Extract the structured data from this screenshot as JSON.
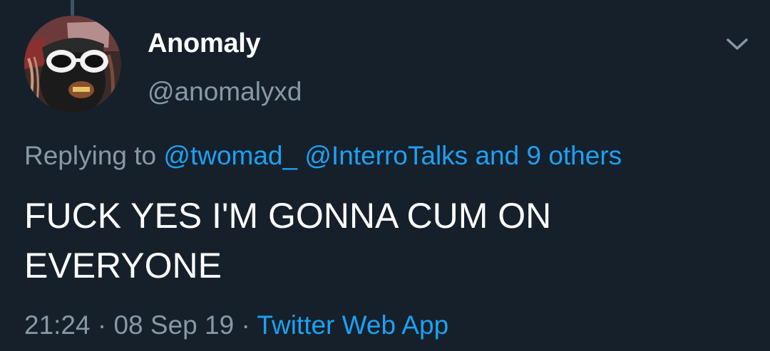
{
  "tweet": {
    "author_name": "Anomaly",
    "author_handle": "@anomalyxd",
    "replying_prefix": "Replying to ",
    "reply_mention_1": "@twomad_",
    "reply_mention_2": "@InterroTalks",
    "reply_others": "and 9 others",
    "text_line_1": "FUCK YES I'M GONNA CUM ON",
    "text_line_2": "EVERYONE",
    "time": "21:24",
    "date": "08 Sep 19",
    "source": "Twitter Web App",
    "separator": " · "
  },
  "icons": {
    "menu": "chevron-down-icon",
    "avatar": "profile-avatar"
  },
  "colors": {
    "background": "#15202b",
    "secondary_text": "#8899a6",
    "link": "#1da1f2",
    "primary_text": "#ffffff"
  }
}
